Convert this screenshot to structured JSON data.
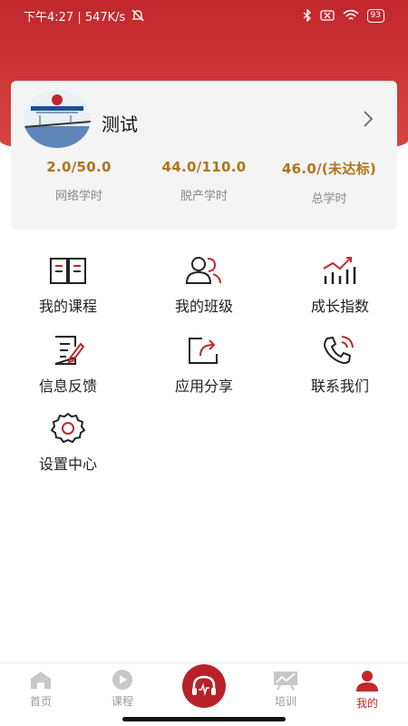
{
  "status_bar": {
    "left_text": "下午4:27 | 547K/s",
    "battery": "93"
  },
  "profile": {
    "name": "测试",
    "stats": [
      {
        "value": "2.0/50.0",
        "label": "网络学时"
      },
      {
        "value": "44.0/110.0",
        "label": "脱产学时"
      },
      {
        "value": "46.0/(未达标)",
        "label": "总学时"
      }
    ]
  },
  "menu": [
    {
      "label": "我的课程",
      "icon": "book-icon"
    },
    {
      "label": "我的班级",
      "icon": "users-icon"
    },
    {
      "label": "成长指数",
      "icon": "chart-icon"
    },
    {
      "label": "信息反馈",
      "icon": "edit-doc-icon"
    },
    {
      "label": "应用分享",
      "icon": "share-icon"
    },
    {
      "label": "联系我们",
      "icon": "phone-icon"
    },
    {
      "label": "设置中心",
      "icon": "gear-icon"
    }
  ],
  "tabs": [
    {
      "label": "首页",
      "icon": "home-icon"
    },
    {
      "label": "课程",
      "icon": "play-icon"
    },
    {
      "label": "",
      "icon": "headphones-icon"
    },
    {
      "label": "培训",
      "icon": "training-icon"
    },
    {
      "label": "我的",
      "icon": "user-icon"
    }
  ],
  "colors": {
    "brand_red": "#c1272d",
    "stat_gold": "#b0731a"
  }
}
